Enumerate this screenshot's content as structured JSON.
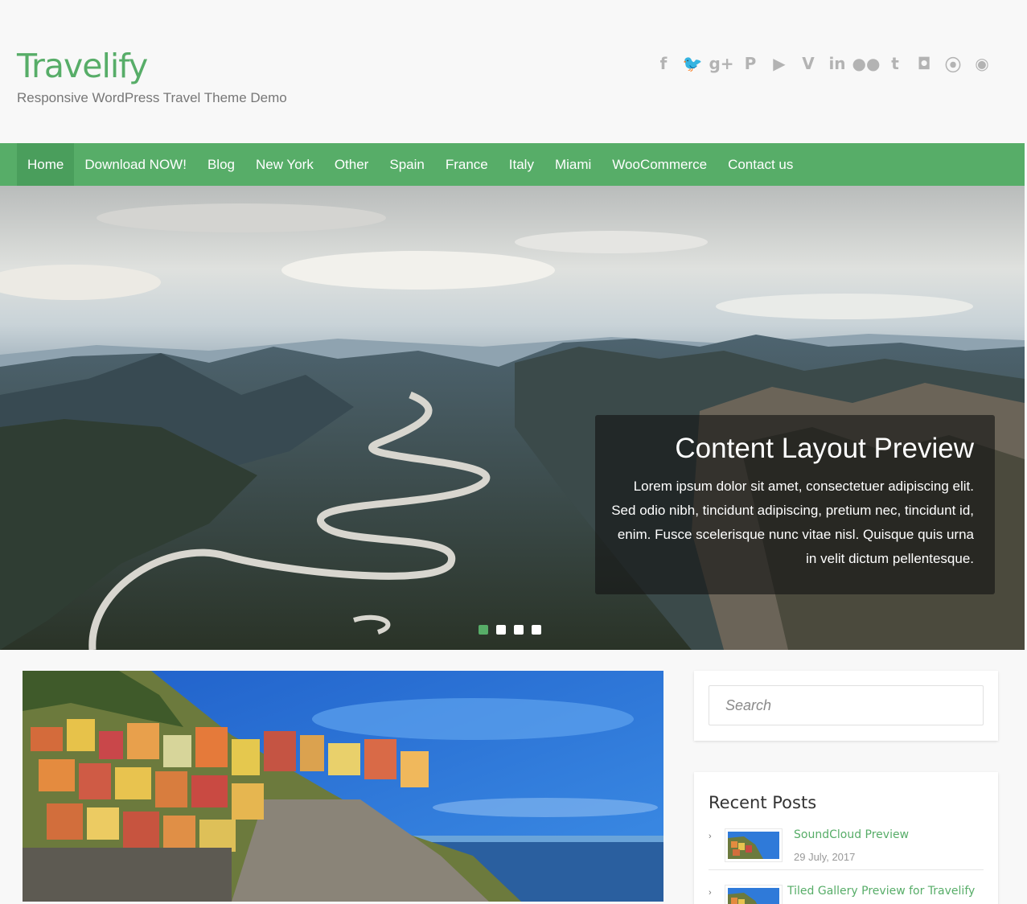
{
  "site": {
    "title": "Travelify",
    "tagline": "Responsive WordPress Travel Theme Demo"
  },
  "social": [
    {
      "icon": "facebook-icon",
      "glyph": "f"
    },
    {
      "icon": "twitter-icon",
      "glyph": "🐦"
    },
    {
      "icon": "google-plus-icon",
      "glyph": "g+"
    },
    {
      "icon": "pinterest-icon",
      "glyph": "P"
    },
    {
      "icon": "youtube-icon",
      "glyph": "▶"
    },
    {
      "icon": "vimeo-icon",
      "glyph": "V"
    },
    {
      "icon": "linkedin-icon",
      "glyph": "in"
    },
    {
      "icon": "flickr-icon",
      "glyph": "●●"
    },
    {
      "icon": "tumblr-icon",
      "glyph": "t"
    },
    {
      "icon": "instagram-icon",
      "glyph": "◘"
    },
    {
      "icon": "rss-icon",
      "glyph": "⦿"
    },
    {
      "icon": "github-icon",
      "glyph": "◉"
    }
  ],
  "nav": {
    "items": [
      "Home",
      "Download NOW!",
      "Blog",
      "New York",
      "Other",
      "Spain",
      "France",
      "Italy",
      "Miami",
      "WooCommerce",
      "Contact us"
    ],
    "active": "Home"
  },
  "slider": {
    "caption_title": "Content Layout Preview",
    "caption_text": "Lorem ipsum dolor sit amet, consectetuer adipiscing elit. Sed odio nibh, tincidunt adipiscing, pretium nec, tincidunt id, enim. Fusce scelerisque nunc vitae nisl. Quisque quis urna in velit dictum pellentesque.",
    "slides": 4,
    "current_slide": 1
  },
  "sidebar": {
    "search_placeholder": "Search",
    "recent_title": "Recent Posts",
    "recent_posts": [
      {
        "title": "SoundCloud Preview",
        "date": "29 July, 2017"
      },
      {
        "title": "Tiled Gallery Preview for Travelify",
        "date": ""
      }
    ]
  },
  "colors": {
    "brand_green": "#57ad68",
    "nav_active": "#4a9e5c"
  }
}
